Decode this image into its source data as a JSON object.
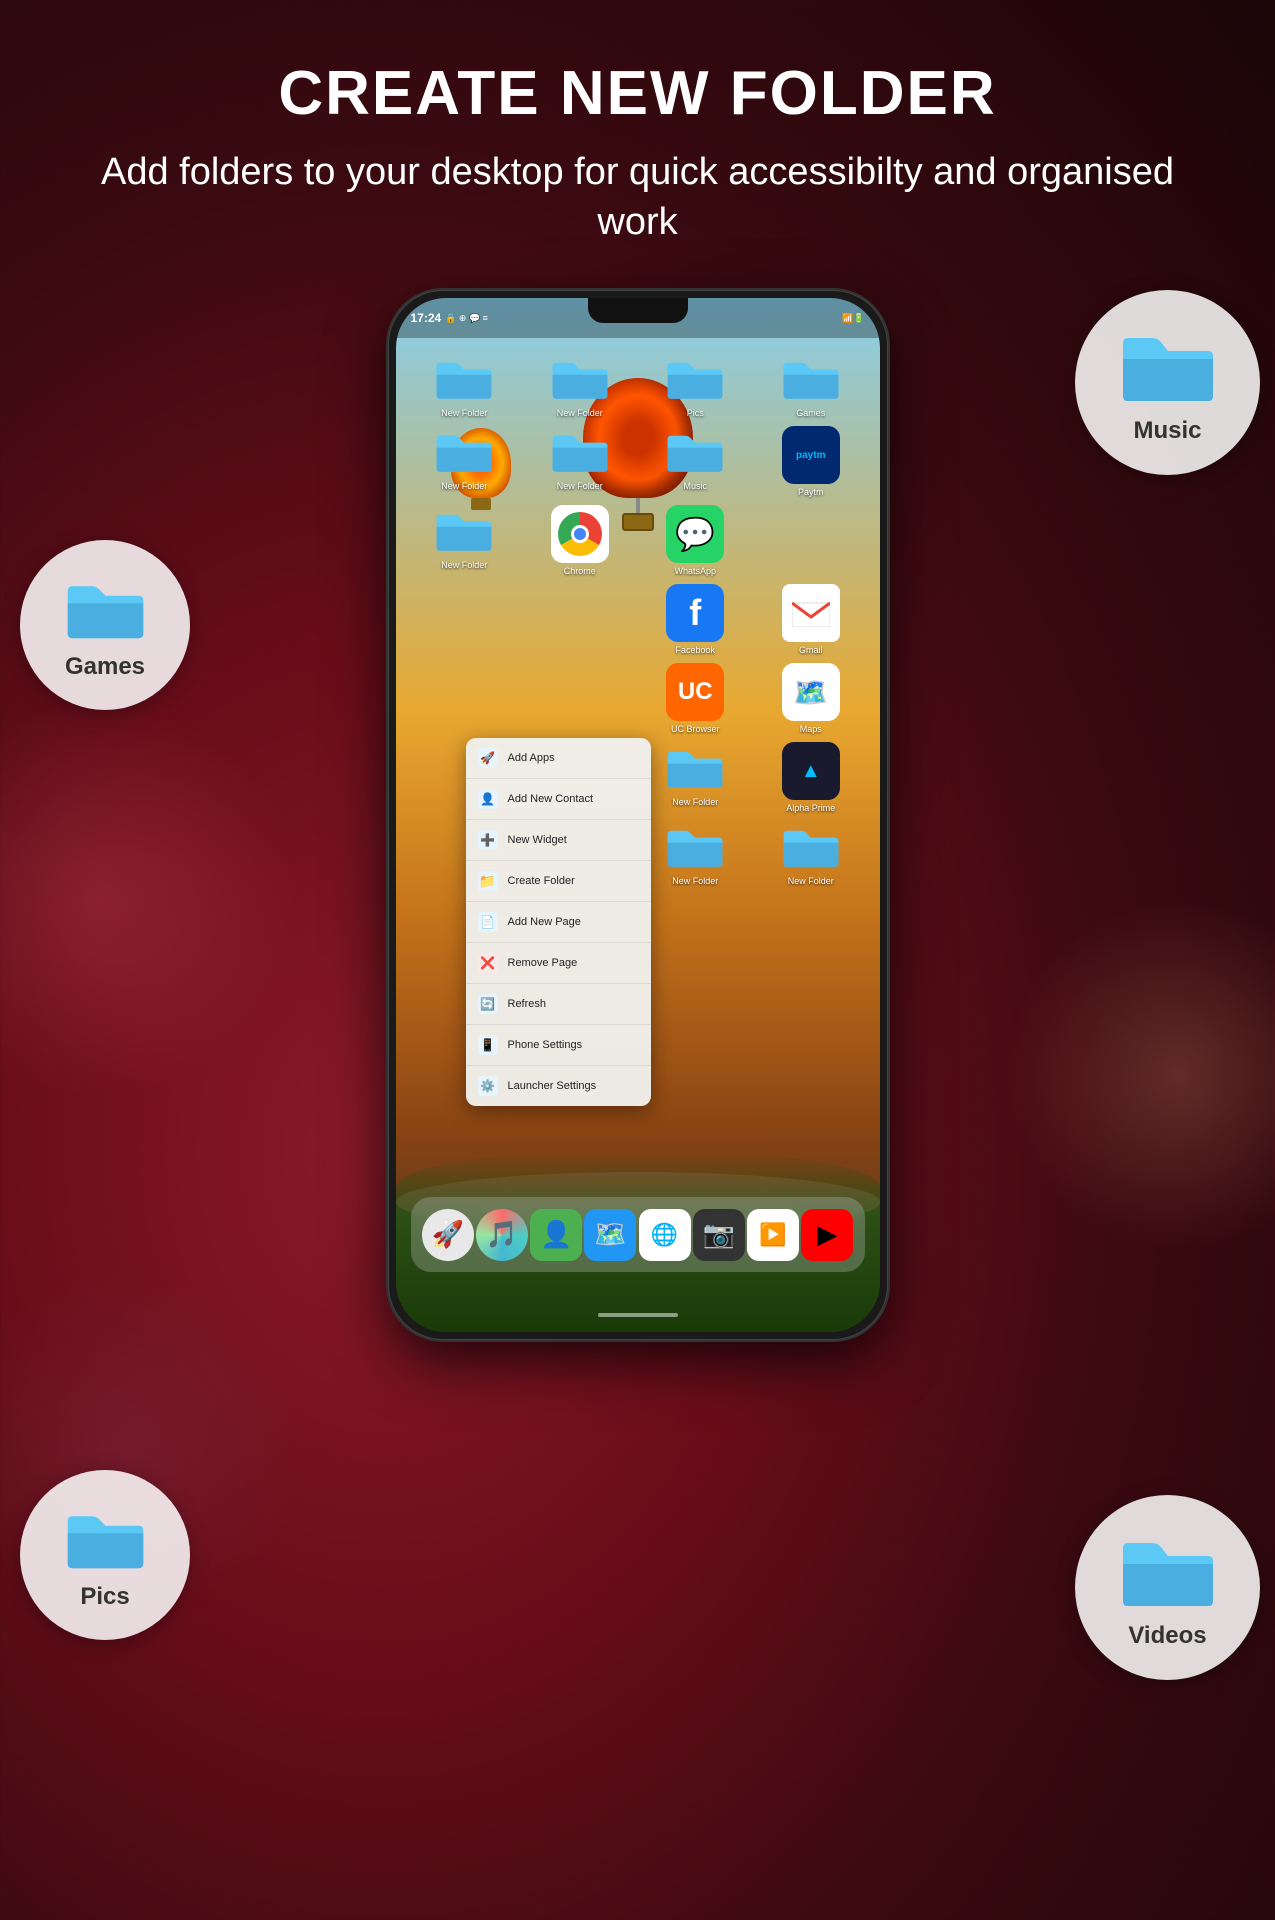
{
  "header": {
    "title": "CREATE NEW FOLDER",
    "subtitle": "Add folders to your desktop for quick accessibilty and organised work"
  },
  "phone": {
    "status_bar": {
      "time": "17:24",
      "icons": "📶 🔋"
    }
  },
  "app_grid": {
    "row1": [
      {
        "label": "New Folder",
        "type": "folder"
      },
      {
        "label": "New Folder",
        "type": "folder"
      },
      {
        "label": "Pics",
        "type": "folder"
      },
      {
        "label": "Games",
        "type": "folder"
      }
    ],
    "row2": [
      {
        "label": "New Folder",
        "type": "folder"
      },
      {
        "label": "New Folder",
        "type": "folder"
      },
      {
        "label": "Music",
        "type": "folder"
      },
      {
        "label": "Paytm",
        "type": "paytm"
      }
    ],
    "row3": [
      {
        "label": "New Folder",
        "type": "folder"
      },
      {
        "label": "Chrome",
        "type": "chrome"
      },
      {
        "label": "WhatsApp",
        "type": "whatsapp"
      }
    ],
    "row4_right": [
      {
        "label": "Facebook",
        "type": "facebook"
      },
      {
        "label": "Gmail",
        "type": "gmail"
      }
    ],
    "row5": [
      {
        "label": "UC Browser",
        "type": "uc"
      },
      {
        "label": "Maps",
        "type": "maps"
      }
    ],
    "row6": [
      {
        "label": "New Folder",
        "type": "folder"
      },
      {
        "label": "Alpha Prime",
        "type": "alpha"
      }
    ],
    "row7": [
      {
        "label": "New Folder",
        "type": "folder"
      },
      {
        "label": "New Folder",
        "type": "folder"
      }
    ]
  },
  "context_menu": {
    "items": [
      {
        "label": "Add Apps",
        "icon": "🚀"
      },
      {
        "label": "Add New Contact",
        "icon": "👤"
      },
      {
        "label": "New Widget",
        "icon": "➕"
      },
      {
        "label": "Create Folder",
        "icon": "📁"
      },
      {
        "label": "Add New Page",
        "icon": "📄"
      },
      {
        "label": "Remove Page",
        "icon": "❌"
      },
      {
        "label": "Refresh",
        "icon": "🔄"
      },
      {
        "label": "Phone Settings",
        "icon": "📱"
      },
      {
        "label": "Launcher Settings",
        "icon": "⚙️"
      }
    ]
  },
  "float_circles": {
    "games": {
      "label": "Games"
    },
    "music": {
      "label": "Music"
    },
    "pics": {
      "label": "Pics"
    },
    "videos": {
      "label": "Videos"
    }
  },
  "dock": {
    "apps": [
      "🚀",
      "🎵",
      "👤",
      "🗺️",
      "🌐",
      "📷",
      "▶️",
      "🎬"
    ]
  }
}
